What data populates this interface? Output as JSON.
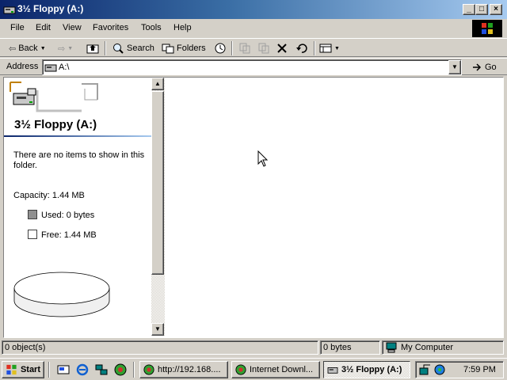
{
  "window": {
    "title": "3½ Floppy (A:)",
    "buttons": {
      "minimize": "_",
      "maximize": "□",
      "close": "×"
    }
  },
  "menu": [
    "File",
    "Edit",
    "View",
    "Favorites",
    "Tools",
    "Help"
  ],
  "toolbar": {
    "back": "Back",
    "search": "Search",
    "folders": "Folders"
  },
  "address": {
    "label": "Address",
    "value": "A:\\",
    "go": "Go"
  },
  "left_panel": {
    "title": "3½ Floppy (A:)",
    "empty_message_line1": "There are no items to show in this",
    "empty_message_line2": "folder.",
    "capacity": "Capacity: 1.44 MB",
    "used": "Used: 0 bytes",
    "free": "Free: 1.44 MB",
    "used_fraction": 0.0
  },
  "status": {
    "objects": "0 object(s)",
    "size": "0 bytes",
    "zone": "My Computer"
  },
  "taskbar": {
    "start": "Start",
    "tasks": [
      {
        "label": "http://192.168...."
      },
      {
        "label": "Internet Downl..."
      },
      {
        "label": "3½ Floppy (A:)"
      }
    ],
    "clock": "7:59 PM"
  },
  "colors": {
    "title_gradient_start": "#0a246a",
    "title_gradient_end": "#a6caf0",
    "face": "#d4d0c8"
  }
}
